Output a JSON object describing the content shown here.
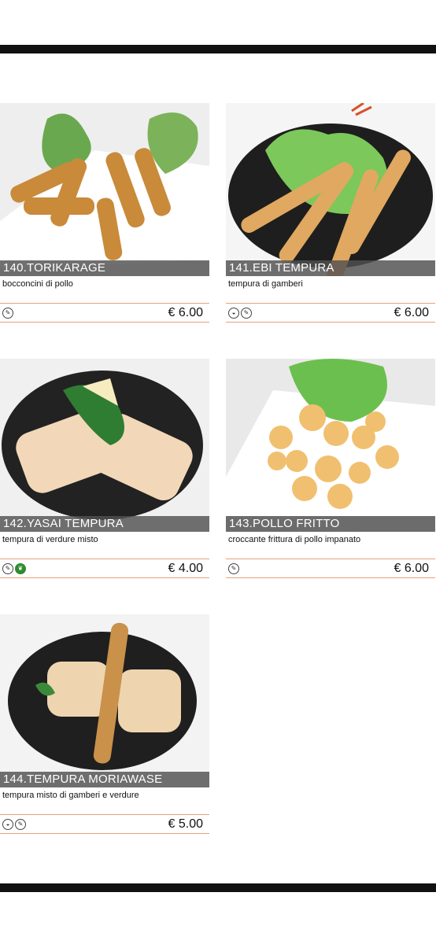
{
  "items": [
    {
      "title": "140.TORIKARAGE",
      "desc": "bocconcini di pollo",
      "price": "€ 6.00",
      "icons": [
        "pencil-icon"
      ]
    },
    {
      "title": "141.EBI TEMPURA",
      "desc": "tempura di gamberi",
      "price": "€ 6.00",
      "icons": [
        "shrimp-icon",
        "pencil-icon"
      ]
    },
    {
      "title": "142.YASAI TEMPURA",
      "desc": "tempura di verdure misto",
      "price": "€ 4.00",
      "icons": [
        "pencil-icon",
        "leaf-icon"
      ]
    },
    {
      "title": "143.POLLO FRITTO",
      "desc": "croccante frittura di pollo impanato",
      "price": "€ 6.00",
      "icons": [
        "pencil-icon"
      ]
    },
    {
      "title": "144.TEMPURA MORIAWASE",
      "desc": "tempura misto di gamberi e verdure",
      "price": "€ 5.00",
      "icons": [
        "shrimp-icon",
        "pencil-icon"
      ]
    }
  ],
  "colors": {
    "accent": "#e8a07a",
    "band": "#505050"
  }
}
